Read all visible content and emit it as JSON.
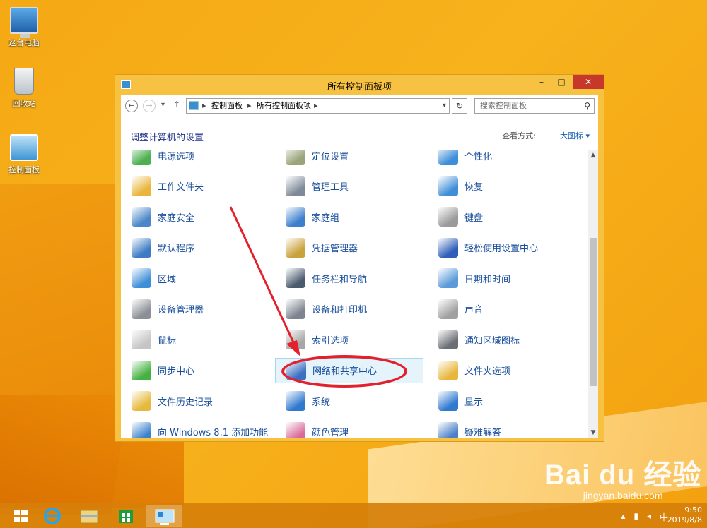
{
  "desktop": {
    "icons": [
      {
        "label": "这台电脑"
      },
      {
        "label": "回收站"
      },
      {
        "label": "控制面板"
      }
    ]
  },
  "window": {
    "title": "所有控制面板项",
    "controls": {
      "minimize": "–",
      "maximize": "□",
      "close": "✕"
    }
  },
  "nav": {
    "breadcrumb": [
      "控制面板",
      "所有控制面板项"
    ],
    "search_placeholder": "搜索控制面板"
  },
  "header": {
    "title": "调整计算机的设置",
    "view_by_label": "查看方式:",
    "view_by_value": "大图标 ▾"
  },
  "items": [
    [
      {
        "label": "电源选项",
        "icon": "power-icon",
        "color": "#4caf50"
      },
      {
        "label": "工作文件夹",
        "icon": "work-folder-icon",
        "color": "#e9b53a"
      },
      {
        "label": "家庭安全",
        "icon": "family-safety-icon",
        "color": "#4a86c8"
      },
      {
        "label": "默认程序",
        "icon": "default-programs-icon",
        "color": "#3d7bc4"
      },
      {
        "label": "区域",
        "icon": "region-icon",
        "color": "#3f8fd8"
      },
      {
        "label": "设备管理器",
        "icon": "device-manager-icon",
        "color": "#8b8f96"
      },
      {
        "label": "鼠标",
        "icon": "mouse-icon",
        "color": "#c5c5c5"
      },
      {
        "label": "同步中心",
        "icon": "sync-center-icon",
        "color": "#45b142"
      },
      {
        "label": "文件历史记录",
        "icon": "file-history-icon",
        "color": "#e6b93c"
      },
      {
        "label": "向 Windows 8.1 添加功能",
        "icon": "add-features-icon",
        "color": "#3a82cc"
      }
    ],
    [
      {
        "label": "定位设置",
        "icon": "location-icon",
        "color": "#9aa37a"
      },
      {
        "label": "管理工具",
        "icon": "admin-tools-icon",
        "color": "#7f8a99"
      },
      {
        "label": "家庭组",
        "icon": "homegroup-icon",
        "color": "#3c7fcd"
      },
      {
        "label": "凭据管理器",
        "icon": "credential-manager-icon",
        "color": "#c9a23b"
      },
      {
        "label": "任务栏和导航",
        "icon": "taskbar-navigation-icon",
        "color": "#4a5b6e"
      },
      {
        "label": "设备和打印机",
        "icon": "devices-printers-icon",
        "color": "#7d8490"
      },
      {
        "label": "索引选项",
        "icon": "indexing-icon",
        "color": "#a7a7a7"
      },
      {
        "label": "网络和共享中心",
        "icon": "network-sharing-icon",
        "color": "#3b6fc2"
      },
      {
        "label": "系统",
        "icon": "system-icon",
        "color": "#2f79cf"
      },
      {
        "label": "颜色管理",
        "icon": "color-management-icon",
        "color": "#d96a9a"
      }
    ],
    [
      {
        "label": "个性化",
        "icon": "personalization-icon",
        "color": "#3f8ed8"
      },
      {
        "label": "恢复",
        "icon": "recovery-icon",
        "color": "#3f8ed8"
      },
      {
        "label": "键盘",
        "icon": "keyboard-icon",
        "color": "#9a9a9a"
      },
      {
        "label": "轻松使用设置中心",
        "icon": "ease-of-access-icon",
        "color": "#2f5fb8"
      },
      {
        "label": "日期和时间",
        "icon": "date-time-icon",
        "color": "#5a9ad8"
      },
      {
        "label": "声音",
        "icon": "sound-icon",
        "color": "#a0a0a0"
      },
      {
        "label": "通知区域图标",
        "icon": "notification-area-icon",
        "color": "#6b6f75"
      },
      {
        "label": "文件夹选项",
        "icon": "folder-options-icon",
        "color": "#e8b63c"
      },
      {
        "label": "显示",
        "icon": "display-icon",
        "color": "#2f79cf"
      },
      {
        "label": "疑难解答",
        "icon": "troubleshooting-icon",
        "color": "#4a7fc9"
      }
    ]
  ],
  "highlighted_item": "网络和共享中心",
  "taskbar": {
    "ime": "中",
    "time": "9:50",
    "date": "2019/8/8"
  },
  "watermark": {
    "logo": "Bai du 经验",
    "url": "jingyan.baidu.com"
  },
  "colors": {
    "link": "#1a4f9c",
    "heading": "#1e3287",
    "annotation": "#e3202b",
    "close": "#c7382b"
  }
}
